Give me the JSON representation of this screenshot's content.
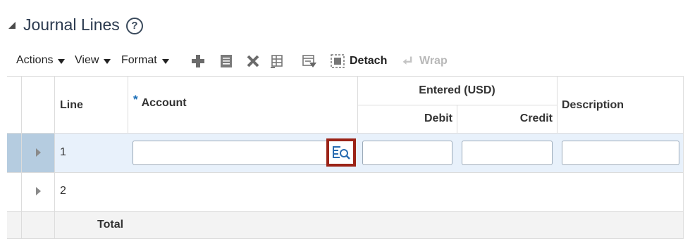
{
  "section": {
    "title": "Journal Lines",
    "help_glyph": "?"
  },
  "toolbar": {
    "menus": [
      {
        "label": "Actions"
      },
      {
        "label": "View"
      },
      {
        "label": "Format"
      }
    ],
    "icons": [
      "add-icon",
      "edit-icon",
      "delete-icon",
      "freeze-icon",
      "query-by-example-icon",
      "detach-icon",
      "wrap-icon"
    ],
    "detach_label": "Detach",
    "wrap_label": "Wrap"
  },
  "table": {
    "headers": {
      "line": "Line",
      "required_marker": "*",
      "account": "Account",
      "entered_group": "Entered (USD)",
      "debit": "Debit",
      "credit": "Credit",
      "description": "Description"
    },
    "rows": [
      {
        "line": "1",
        "selected": true
      },
      {
        "line": "2",
        "selected": false
      }
    ],
    "total_label": "Total"
  },
  "colors": {
    "selected_row": "#e8f1fb",
    "selected_indicator": "#b5cce0",
    "highlight_border": "#9b2317",
    "lookup_icon": "#2a6cb0",
    "required_marker": "#1d6fb8"
  }
}
